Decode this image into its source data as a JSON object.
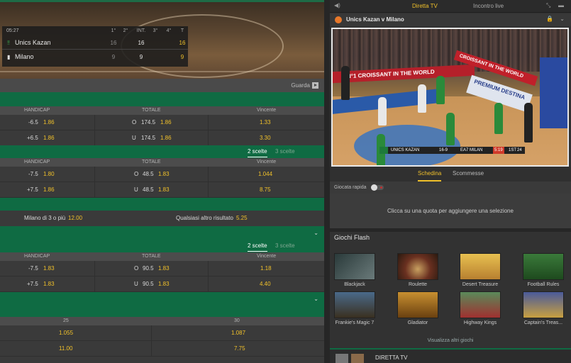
{
  "scoreboard": {
    "clock": "05:27",
    "periods": [
      "1°",
      "2°",
      "INT.",
      "3°",
      "4°",
      "T"
    ],
    "teams": [
      {
        "name": "Unics Kazan",
        "q1": "16",
        "q2": "",
        "int": "16",
        "q3": "",
        "q4": "",
        "total": "16"
      },
      {
        "name": "Milano",
        "q1": "9",
        "q2": "",
        "int": "9",
        "q3": "",
        "q4": "",
        "total": "9"
      }
    ]
  },
  "guarda_label": "Guarda",
  "market1": {
    "headers": [
      "HANDICAP",
      "TOTALE",
      "Vincente"
    ],
    "rows": [
      {
        "hcp": "-6.5",
        "hcp_odd": "1.86",
        "tot_side": "O",
        "tot_line": "174.5",
        "tot_odd": "1.86",
        "win": "1.33"
      },
      {
        "hcp": "+6.5",
        "hcp_odd": "1.86",
        "tot_side": "U",
        "tot_line": "174.5",
        "tot_odd": "1.86",
        "win": "3.30"
      }
    ]
  },
  "tabs_a": {
    "active": "2 scelte",
    "inactive": "3 scelte"
  },
  "market2": {
    "headers": [
      "HANDICAP",
      "TOTALE",
      "Vincente"
    ],
    "rows": [
      {
        "hcp": "-7.5",
        "hcp_odd": "1.80",
        "tot_side": "O",
        "tot_line": "48.5",
        "tot_odd": "1.83",
        "win": "1.044"
      },
      {
        "hcp": "+7.5",
        "hcp_odd": "1.86",
        "tot_side": "U",
        "tot_line": "48.5",
        "tot_odd": "1.83",
        "win": "8.75"
      }
    ]
  },
  "special": {
    "left_label": "Milano di 3 o più",
    "left_odd": "12.00",
    "right_label": "Qualsiasi altro risultato",
    "right_odd": "5.25"
  },
  "tabs_b": {
    "active": "2 scelte",
    "inactive": "3 scelte"
  },
  "market3": {
    "headers": [
      "HANDICAP",
      "TOTALE",
      "Vincente"
    ],
    "rows": [
      {
        "hcp": "-7.5",
        "hcp_odd": "1.83",
        "tot_side": "O",
        "tot_line": "90.5",
        "tot_odd": "1.83",
        "win": "1.18"
      },
      {
        "hcp": "+7.5",
        "hcp_odd": "1.83",
        "tot_side": "U",
        "tot_line": "90.5",
        "tot_odd": "1.83",
        "win": "4.40"
      }
    ]
  },
  "market4": {
    "headers": [
      "25",
      "30"
    ],
    "rows": [
      {
        "a": "1.055",
        "b": "1.087"
      },
      {
        "a": "11.00",
        "b": "7.75"
      }
    ]
  },
  "right": {
    "tab_active": "Diretta TV",
    "tab_inactive": "Incontro live",
    "match_title": "Unics Kazan v Milano",
    "video_ads": {
      "band": "N°1 CROISSANT IN THE WORLD",
      "band2": "CROISSANT IN THE WORLD",
      "premium": "PREMIUM DESTINA"
    },
    "video_score": {
      "home": "UNICS KAZAN",
      "score": "16-9",
      "away": "EA7 MILAN",
      "clock": "5:19",
      "period": "1ST",
      "shot": "24"
    },
    "bet_tabs": {
      "active": "Schedina",
      "inactive": "Scommesse"
    },
    "quick_label": "Giocata rapida",
    "empty_msg": "Clicca su una quota per aggiungere una selezione",
    "flash_title": "Giochi Flash",
    "games": [
      "Blackjack",
      "Roulette",
      "Desert Treasure",
      "Football Rules",
      "Frankie's Magic 7",
      "Gladiator",
      "Highway Kings",
      "Captain's Treas..."
    ],
    "more_games": "Visualizza altri giochi",
    "bottom_title": "DIRETTA TV"
  },
  "colors": {
    "accent_green": "#0f6b43",
    "odds_yellow": "#f0c02a",
    "tab_yellow": "#f0c02a"
  }
}
